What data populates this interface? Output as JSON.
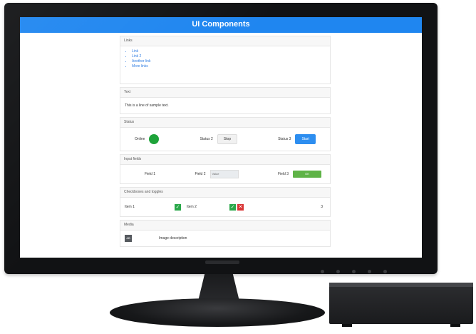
{
  "page": {
    "title": "UI Components",
    "sections": {
      "links": {
        "label": "Links",
        "items": [
          "Link",
          "Link 2",
          "Another link",
          "More links"
        ]
      },
      "text": {
        "label": "Text",
        "content": "This is a line of sample text."
      },
      "status": {
        "label": "Status",
        "led_label": "Online",
        "button1_label": "Status 2",
        "button1_text": "Stop",
        "button2_label": "Status 3",
        "button2_text": "Start"
      },
      "fields": {
        "label": "Input fields",
        "field1_label": "Field 1",
        "field2_label": "Field 2",
        "field2_value": "Value",
        "field3_label": "Field 3",
        "field3_value": "OK"
      },
      "checkboxes": {
        "label": "Checkboxes and toggles",
        "item1_label": "Item 1",
        "item2_label": "Item 2",
        "item3_label": "3"
      },
      "media": {
        "label": "Media",
        "avatar_text": "AB",
        "caption": "Image description"
      }
    }
  },
  "colors": {
    "header": "#1f86f0",
    "led": "#1ea33a",
    "primary_button": "#2d8ef0",
    "success": "#2aa84a",
    "danger": "#d93636"
  }
}
